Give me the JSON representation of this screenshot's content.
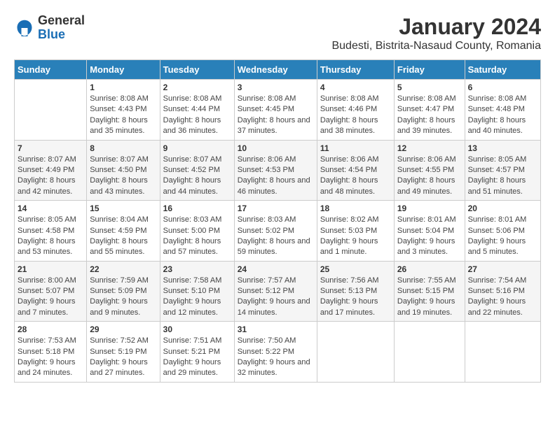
{
  "logo": {
    "general": "General",
    "blue": "Blue"
  },
  "header": {
    "title": "January 2024",
    "subtitle": "Budesti, Bistrita-Nasaud County, Romania"
  },
  "weekdays": [
    "Sunday",
    "Monday",
    "Tuesday",
    "Wednesday",
    "Thursday",
    "Friday",
    "Saturday"
  ],
  "weeks": [
    [
      {
        "day": "",
        "sunrise": "",
        "sunset": "",
        "daylight": ""
      },
      {
        "day": "1",
        "sunrise": "Sunrise: 8:08 AM",
        "sunset": "Sunset: 4:43 PM",
        "daylight": "Daylight: 8 hours and 35 minutes."
      },
      {
        "day": "2",
        "sunrise": "Sunrise: 8:08 AM",
        "sunset": "Sunset: 4:44 PM",
        "daylight": "Daylight: 8 hours and 36 minutes."
      },
      {
        "day": "3",
        "sunrise": "Sunrise: 8:08 AM",
        "sunset": "Sunset: 4:45 PM",
        "daylight": "Daylight: 8 hours and 37 minutes."
      },
      {
        "day": "4",
        "sunrise": "Sunrise: 8:08 AM",
        "sunset": "Sunset: 4:46 PM",
        "daylight": "Daylight: 8 hours and 38 minutes."
      },
      {
        "day": "5",
        "sunrise": "Sunrise: 8:08 AM",
        "sunset": "Sunset: 4:47 PM",
        "daylight": "Daylight: 8 hours and 39 minutes."
      },
      {
        "day": "6",
        "sunrise": "Sunrise: 8:08 AM",
        "sunset": "Sunset: 4:48 PM",
        "daylight": "Daylight: 8 hours and 40 minutes."
      }
    ],
    [
      {
        "day": "7",
        "sunrise": "Sunrise: 8:07 AM",
        "sunset": "Sunset: 4:49 PM",
        "daylight": "Daylight: 8 hours and 42 minutes."
      },
      {
        "day": "8",
        "sunrise": "Sunrise: 8:07 AM",
        "sunset": "Sunset: 4:50 PM",
        "daylight": "Daylight: 8 hours and 43 minutes."
      },
      {
        "day": "9",
        "sunrise": "Sunrise: 8:07 AM",
        "sunset": "Sunset: 4:52 PM",
        "daylight": "Daylight: 8 hours and 44 minutes."
      },
      {
        "day": "10",
        "sunrise": "Sunrise: 8:06 AM",
        "sunset": "Sunset: 4:53 PM",
        "daylight": "Daylight: 8 hours and 46 minutes."
      },
      {
        "day": "11",
        "sunrise": "Sunrise: 8:06 AM",
        "sunset": "Sunset: 4:54 PM",
        "daylight": "Daylight: 8 hours and 48 minutes."
      },
      {
        "day": "12",
        "sunrise": "Sunrise: 8:06 AM",
        "sunset": "Sunset: 4:55 PM",
        "daylight": "Daylight: 8 hours and 49 minutes."
      },
      {
        "day": "13",
        "sunrise": "Sunrise: 8:05 AM",
        "sunset": "Sunset: 4:57 PM",
        "daylight": "Daylight: 8 hours and 51 minutes."
      }
    ],
    [
      {
        "day": "14",
        "sunrise": "Sunrise: 8:05 AM",
        "sunset": "Sunset: 4:58 PM",
        "daylight": "Daylight: 8 hours and 53 minutes."
      },
      {
        "day": "15",
        "sunrise": "Sunrise: 8:04 AM",
        "sunset": "Sunset: 4:59 PM",
        "daylight": "Daylight: 8 hours and 55 minutes."
      },
      {
        "day": "16",
        "sunrise": "Sunrise: 8:03 AM",
        "sunset": "Sunset: 5:00 PM",
        "daylight": "Daylight: 8 hours and 57 minutes."
      },
      {
        "day": "17",
        "sunrise": "Sunrise: 8:03 AM",
        "sunset": "Sunset: 5:02 PM",
        "daylight": "Daylight: 8 hours and 59 minutes."
      },
      {
        "day": "18",
        "sunrise": "Sunrise: 8:02 AM",
        "sunset": "Sunset: 5:03 PM",
        "daylight": "Daylight: 9 hours and 1 minute."
      },
      {
        "day": "19",
        "sunrise": "Sunrise: 8:01 AM",
        "sunset": "Sunset: 5:04 PM",
        "daylight": "Daylight: 9 hours and 3 minutes."
      },
      {
        "day": "20",
        "sunrise": "Sunrise: 8:01 AM",
        "sunset": "Sunset: 5:06 PM",
        "daylight": "Daylight: 9 hours and 5 minutes."
      }
    ],
    [
      {
        "day": "21",
        "sunrise": "Sunrise: 8:00 AM",
        "sunset": "Sunset: 5:07 PM",
        "daylight": "Daylight: 9 hours and 7 minutes."
      },
      {
        "day": "22",
        "sunrise": "Sunrise: 7:59 AM",
        "sunset": "Sunset: 5:09 PM",
        "daylight": "Daylight: 9 hours and 9 minutes."
      },
      {
        "day": "23",
        "sunrise": "Sunrise: 7:58 AM",
        "sunset": "Sunset: 5:10 PM",
        "daylight": "Daylight: 9 hours and 12 minutes."
      },
      {
        "day": "24",
        "sunrise": "Sunrise: 7:57 AM",
        "sunset": "Sunset: 5:12 PM",
        "daylight": "Daylight: 9 hours and 14 minutes."
      },
      {
        "day": "25",
        "sunrise": "Sunrise: 7:56 AM",
        "sunset": "Sunset: 5:13 PM",
        "daylight": "Daylight: 9 hours and 17 minutes."
      },
      {
        "day": "26",
        "sunrise": "Sunrise: 7:55 AM",
        "sunset": "Sunset: 5:15 PM",
        "daylight": "Daylight: 9 hours and 19 minutes."
      },
      {
        "day": "27",
        "sunrise": "Sunrise: 7:54 AM",
        "sunset": "Sunset: 5:16 PM",
        "daylight": "Daylight: 9 hours and 22 minutes."
      }
    ],
    [
      {
        "day": "28",
        "sunrise": "Sunrise: 7:53 AM",
        "sunset": "Sunset: 5:18 PM",
        "daylight": "Daylight: 9 hours and 24 minutes."
      },
      {
        "day": "29",
        "sunrise": "Sunrise: 7:52 AM",
        "sunset": "Sunset: 5:19 PM",
        "daylight": "Daylight: 9 hours and 27 minutes."
      },
      {
        "day": "30",
        "sunrise": "Sunrise: 7:51 AM",
        "sunset": "Sunset: 5:21 PM",
        "daylight": "Daylight: 9 hours and 29 minutes."
      },
      {
        "day": "31",
        "sunrise": "Sunrise: 7:50 AM",
        "sunset": "Sunset: 5:22 PM",
        "daylight": "Daylight: 9 hours and 32 minutes."
      },
      {
        "day": "",
        "sunrise": "",
        "sunset": "",
        "daylight": ""
      },
      {
        "day": "",
        "sunrise": "",
        "sunset": "",
        "daylight": ""
      },
      {
        "day": "",
        "sunrise": "",
        "sunset": "",
        "daylight": ""
      }
    ]
  ]
}
